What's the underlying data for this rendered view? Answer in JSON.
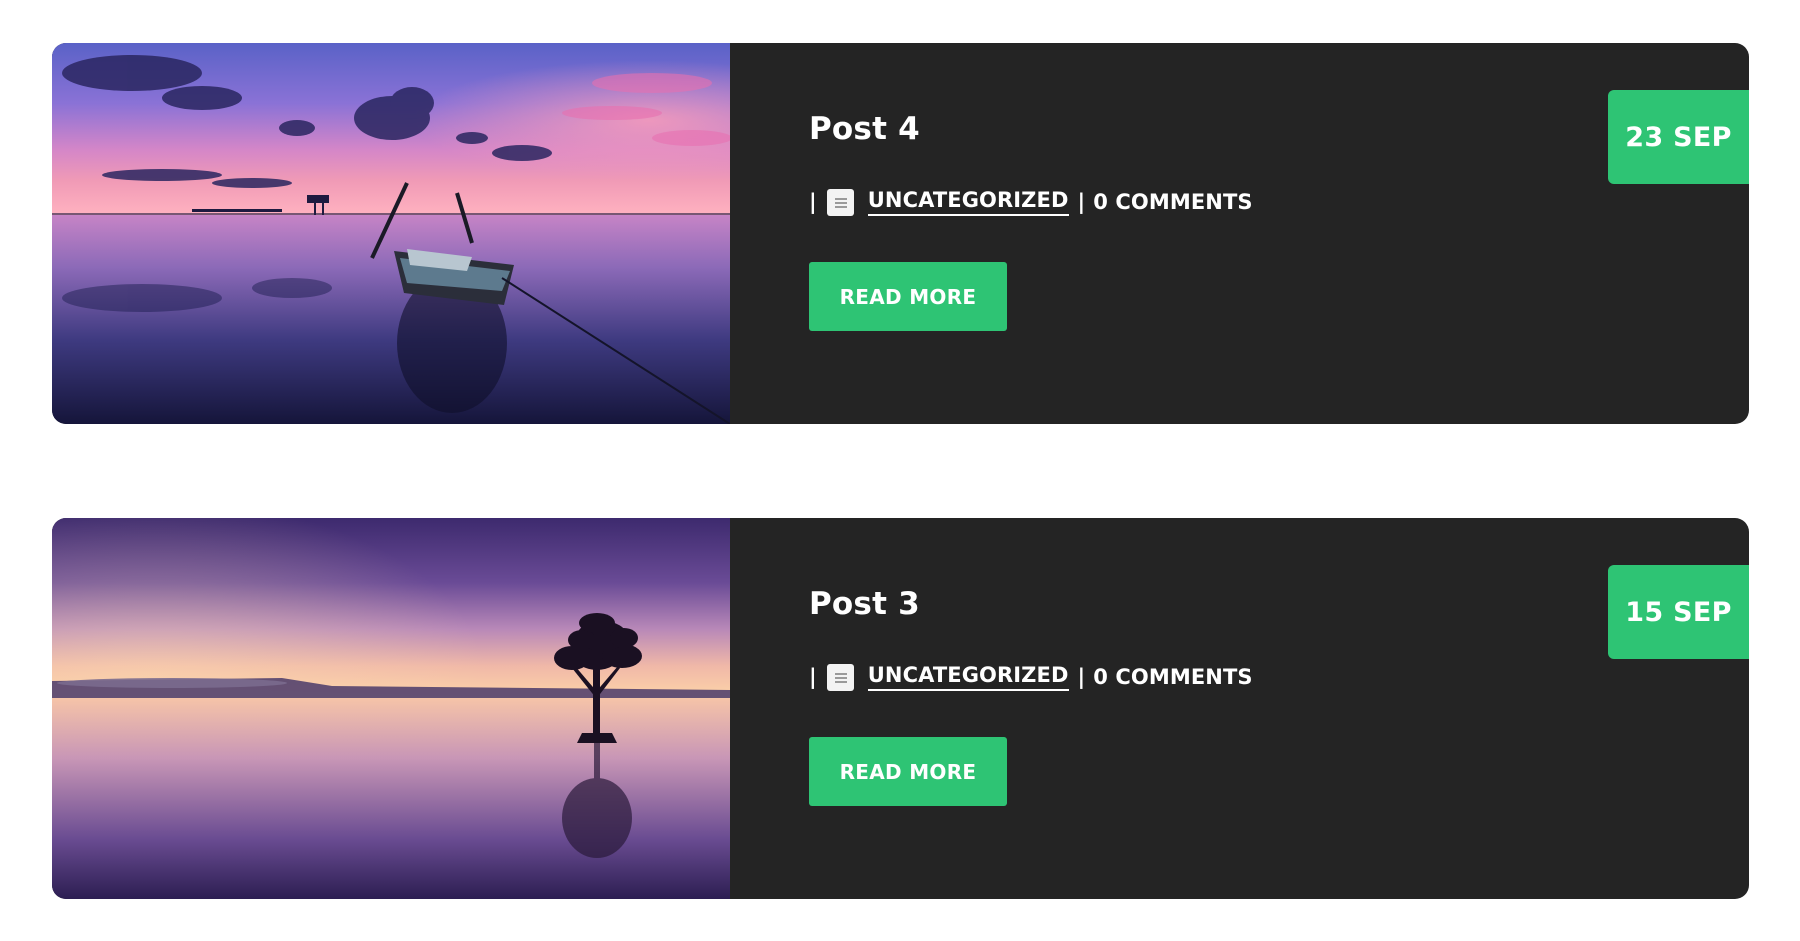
{
  "posts": [
    {
      "title": "Post 4",
      "separator": "|",
      "category": "UNCATEGORIZED",
      "comments": "0 COMMENTS",
      "read_more": "READ MORE",
      "date": "23 SEP",
      "image": "sunset-boat-on-lake"
    },
    {
      "title": "Post 3",
      "separator": "|",
      "category": "UNCATEGORIZED",
      "comments": "0 COMMENTS",
      "read_more": "READ MORE",
      "date": "15 SEP",
      "image": "lone-tree-in-calm-water-at-dusk"
    }
  ],
  "colors": {
    "accent": "#2ec474",
    "card_background": "#242424",
    "page_background": "#ffffff",
    "text": "#ffffff"
  },
  "icons": {
    "category": "document-icon"
  }
}
